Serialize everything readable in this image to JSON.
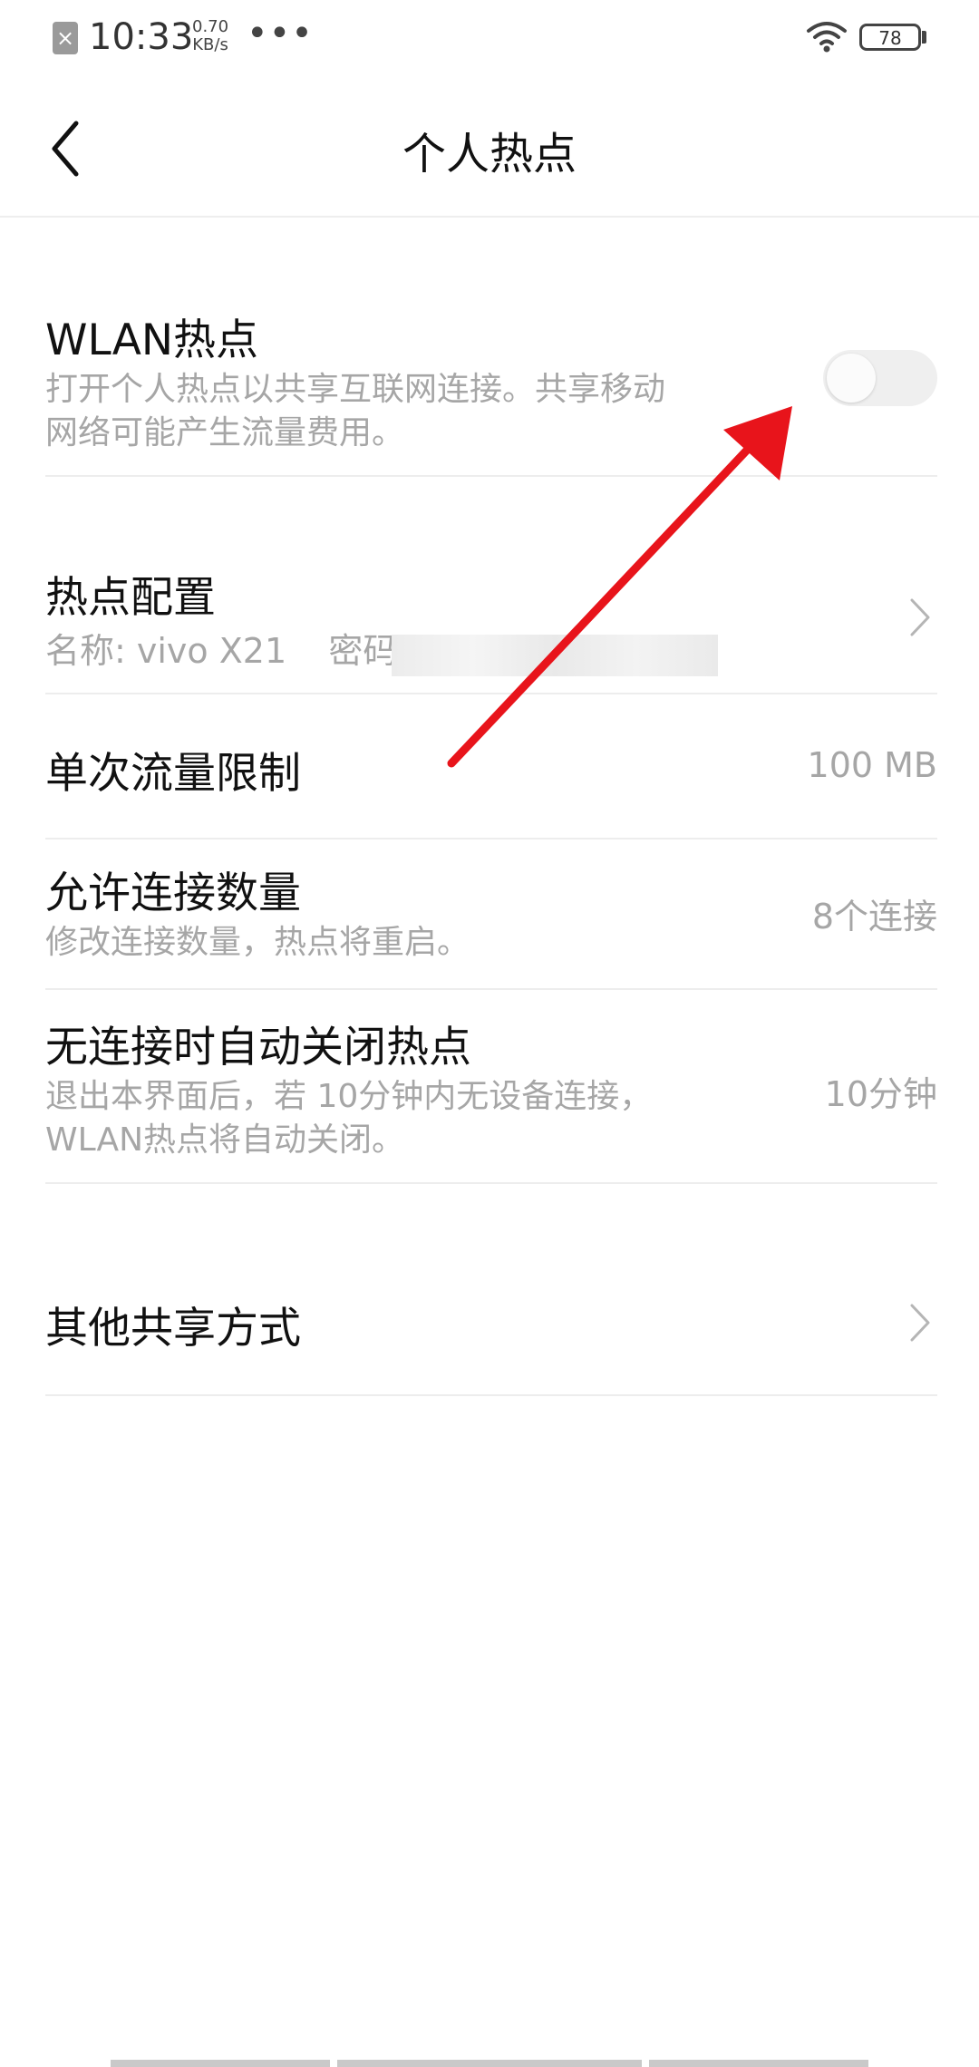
{
  "status_bar": {
    "time": "10:33",
    "speed_value": "0.70",
    "speed_unit": "KB/s",
    "more": "•••",
    "battery": "78",
    "sim_icon": "sim-off-icon",
    "wifi_icon": "wifi-icon"
  },
  "header": {
    "title": "个人热点",
    "back_icon": "chevron-left-icon"
  },
  "hotspot": {
    "title": "WLAN热点",
    "desc_line1": "打开个人热点以共享互联网连接。共享移动",
    "desc_line2": "网络可能产生流量费用。",
    "enabled": false
  },
  "config": {
    "title": "热点配置",
    "name_label": "名称: vivo X21",
    "password_label": "密码:"
  },
  "data_limit": {
    "title": "单次流量限制",
    "value": "100 MB"
  },
  "max_connections": {
    "title": "允许连接数量",
    "desc": "修改连接数量，热点将重启。",
    "value": "8个连接"
  },
  "auto_off": {
    "title": "无连接时自动关闭热点",
    "desc_line1": "退出本界面后，若 10分钟内无设备连接，",
    "desc_line2": "WLAN热点将自动关闭。",
    "value": "10分钟"
  },
  "other_sharing": {
    "title": "其他共享方式"
  },
  "colors": {
    "annotation_arrow": "#e8141b",
    "secondary_text": "#a6a6a6",
    "divider": "#ededed"
  }
}
